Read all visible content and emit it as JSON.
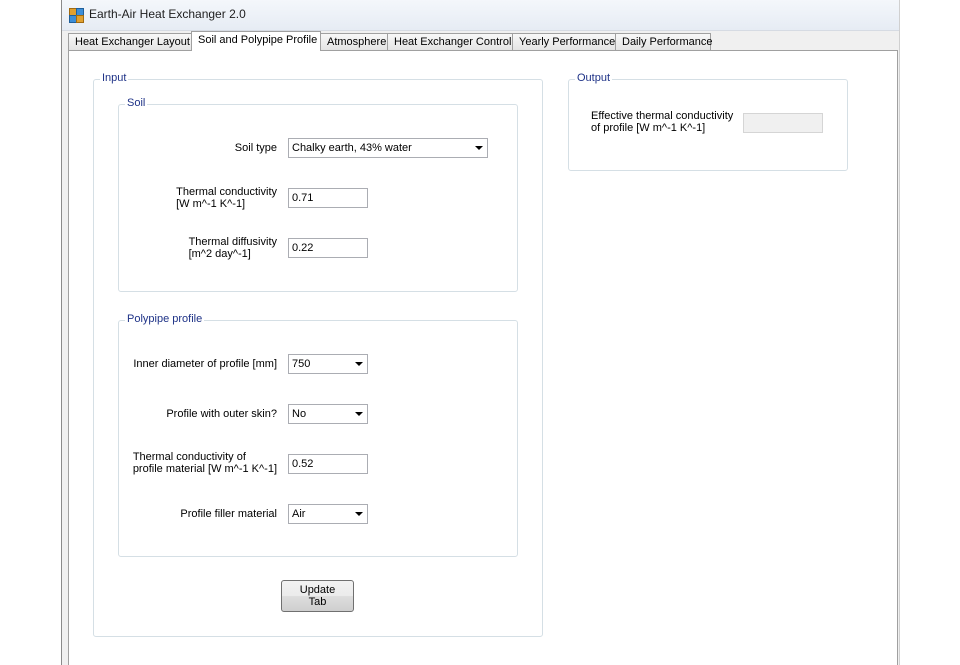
{
  "window": {
    "title": "Earth-Air Heat Exchanger 2.0"
  },
  "tabs": [
    {
      "label": "Heat Exchanger Layout"
    },
    {
      "label": "Soil and Polypipe Profile",
      "active": true
    },
    {
      "label": "Atmosphere"
    },
    {
      "label": "Heat Exchanger Control"
    },
    {
      "label": "Yearly Performance"
    },
    {
      "label": "Daily Performance"
    }
  ],
  "input": {
    "title": "Input",
    "soil": {
      "title": "Soil",
      "soil_type": {
        "label": "Soil type",
        "value": "Chalky earth, 43% water"
      },
      "thermal_conductivity": {
        "label_line1": "Thermal conductivity",
        "label_line2": "[W m^-1 K^-1]",
        "value": "0.71"
      },
      "thermal_diffusivity": {
        "label_line1": "Thermal diffusivity",
        "label_line2": "[m^2 day^-1]",
        "value": "0.22"
      }
    },
    "polypipe": {
      "title": "Polypipe profile",
      "inner_diameter": {
        "label": "Inner diameter of profile [mm]",
        "value": "750"
      },
      "outer_skin": {
        "label": "Profile with outer skin?",
        "value": "No"
      },
      "profile_conductivity": {
        "label_line1": "Thermal conductivity of",
        "label_line2": "profile material [W m^-1 K^-1]",
        "value": "0.52"
      },
      "filler_material": {
        "label": "Profile filler material",
        "value": "Air"
      }
    },
    "update_button": {
      "line1": "Update",
      "line2": "Tab"
    }
  },
  "output": {
    "title": "Output",
    "effective_conductivity": {
      "label_line1": "Effective thermal conductivity",
      "label_line2": "of profile [W m^-1 K^-1]",
      "value": ""
    }
  }
}
